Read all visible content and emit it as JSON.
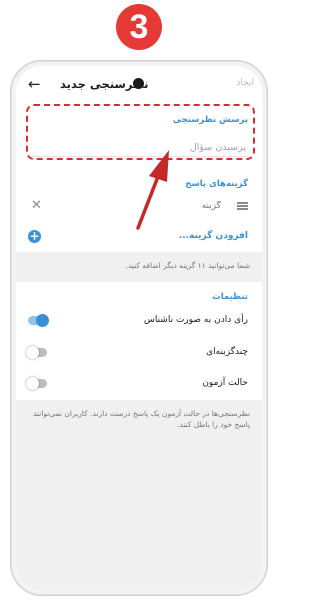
{
  "step_number": "3",
  "header": {
    "title": "نظرسنجی جدید",
    "create_label": "ایجاد"
  },
  "question": {
    "label": "پرسش نظرسنجی",
    "placeholder": "پرسیدن سؤال"
  },
  "options": {
    "label": "گزینه‌های پاسخ",
    "items": [
      {
        "placeholder": "گزینه"
      }
    ],
    "add_label": "افزودن گزینه..."
  },
  "hint": "شما می‌توانید ۱۱ گزینه دیگر اضافه کنید.",
  "settings": {
    "label": "تنظیمات",
    "items": [
      {
        "label": "رأی دادن به صورت ناشناس",
        "state": "on"
      },
      {
        "label": "چندگزینه‌ای",
        "state": "off"
      },
      {
        "label": "حالت آزمون",
        "state": "off"
      }
    ]
  },
  "footer_note": "نظرسنجی‌ها در حالت آزمون یک پاسخ درست دارند. کاربران نمی‌توانند پاسخ خود را باطل کنند.",
  "colors": {
    "accent": "#3a8fd9",
    "highlight": "#d32f2f",
    "badge": "#e53935"
  },
  "icons": {
    "back": "arrow-left-icon",
    "remove": "close-icon",
    "drag": "drag-handle-icon",
    "add": "plus-circle-icon"
  }
}
